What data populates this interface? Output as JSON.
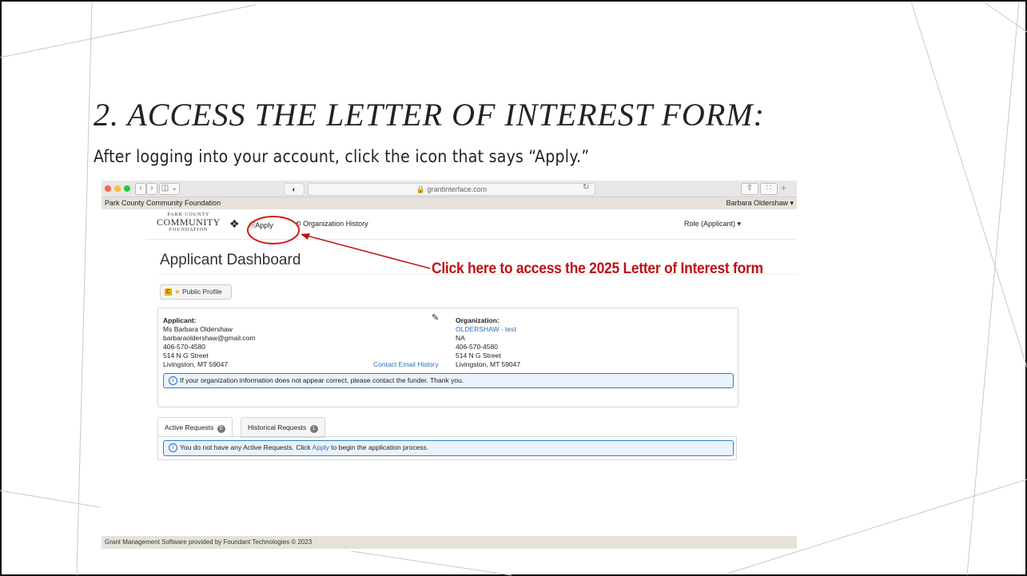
{
  "slide": {
    "title": "2. ACCESS THE LETTER OF INTEREST FORM:",
    "subtitle": "After logging into your account, click the icon that says “Apply.”",
    "callout": "Click here to access the 2025 Letter of Interest form",
    "accent_color": "#c10f14"
  },
  "browser": {
    "url": "grantinterface.com",
    "site_name": "Park County Community Foundation",
    "user_menu": "Barbara Oldershaw ▾"
  },
  "nav": {
    "logo_line1": "PARK COUNTY",
    "logo_line2": "COMMUNITY",
    "logo_line3": "FOUNDATION",
    "apply_label": "Apply",
    "org_history_label": "Organization History",
    "role_label": "Role (Applicant) ▾"
  },
  "dashboard": {
    "title": "Applicant Dashboard",
    "public_profile_label": "Public Profile",
    "applicant": {
      "heading": "Applicant:",
      "name": "Ms Barbara Oldershaw",
      "email": "barbaraoldershaw@gmail.com",
      "phone": "406-570-4580",
      "street": "514 N G Street",
      "city": "Livingston, MT 59047"
    },
    "contact_email_history": "Contact Email History",
    "organization": {
      "heading": "Organization:",
      "name": "OLDERSHAW - test",
      "line2": "NA",
      "phone": "406-570-4580",
      "street": "514 N G Street",
      "city": "Livingston, MT 59047"
    },
    "org_alert": "If your organization information does not appear correct, please contact the funder. Thank you.",
    "tabs": [
      {
        "label": "Active Requests",
        "count": "0"
      },
      {
        "label": "Historical Requests",
        "count": "1"
      }
    ],
    "active_alert_before": "You do not have any Active Requests. Click ",
    "active_alert_link": "Apply",
    "active_alert_after": " to begin the application process."
  },
  "footer": {
    "text": "Grant Management Software provided by Foundant Technologies © 2023"
  }
}
